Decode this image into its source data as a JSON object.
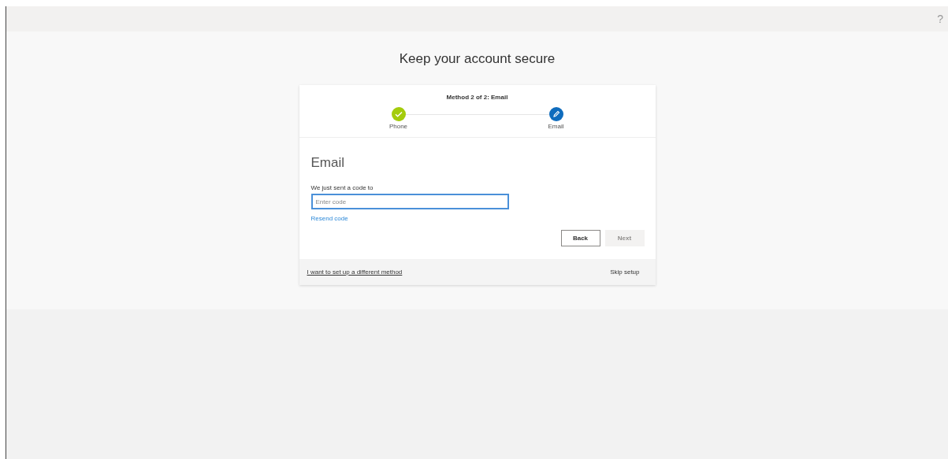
{
  "help_button": "?",
  "title": "Keep your account secure",
  "progress": {
    "caption": "Method 2 of 2: Email",
    "steps": [
      {
        "label": "Phone",
        "kind": "done"
      },
      {
        "label": "Email",
        "kind": "current"
      }
    ]
  },
  "section_title": "Email",
  "code_prompt": "We just sent a code to",
  "code_field": {
    "placeholder": "Enter code",
    "focused": true
  },
  "resend_link": "Resend code",
  "buttons": [
    {
      "label": "Back",
      "disabled": false
    },
    {
      "label": "Next",
      "disabled": true
    }
  ],
  "footer": {
    "different_method_link": "I want to set up a different method",
    "skip_link": "Skip setup"
  }
}
